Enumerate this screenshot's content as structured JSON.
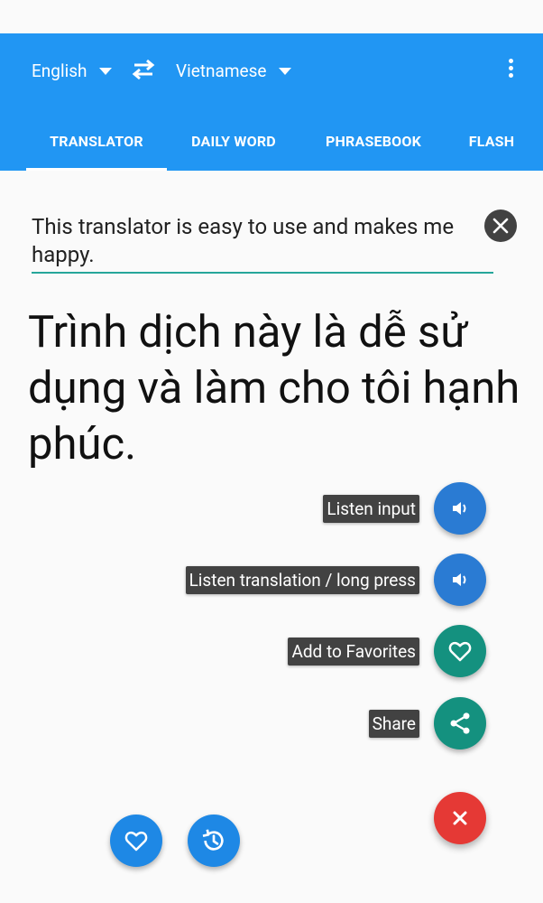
{
  "header": {
    "source_language": "English",
    "target_language": "Vietnamese",
    "swap_icon": "swap-arrows-icon",
    "menu_icon": "more-vert-icon",
    "accent_color": "#2196f3"
  },
  "tabs": [
    {
      "label": "TRANSLATOR",
      "active": true
    },
    {
      "label": "DAILY WORD",
      "active": false
    },
    {
      "label": "PHRASEBOOK",
      "active": false
    },
    {
      "label": "FLASH",
      "active": false
    }
  ],
  "translator": {
    "input_text": "This translator is easy to use and makes me happy.",
    "output_text": "Trình dịch này là dễ sử dụng và làm cho tôi hạnh phúc.",
    "clear_icon": "close-circle-icon",
    "underline_color": "#26a69a"
  },
  "fab_menu": {
    "actions": [
      {
        "label": "Listen input",
        "icon": "volume-icon",
        "color": "#2a7bd3"
      },
      {
        "label": "Listen translation / long press",
        "icon": "volume-icon",
        "color": "#2a7bd3"
      },
      {
        "label": "Add to Favorites",
        "icon": "heart-outline-icon",
        "color": "#14917f"
      },
      {
        "label": "Share",
        "icon": "share-icon",
        "color": "#14917f"
      }
    ],
    "close_icon": "close-icon",
    "close_color": "#e53935"
  },
  "bottom_buttons": [
    {
      "icon": "heart-outline-icon"
    },
    {
      "icon": "history-icon"
    }
  ]
}
